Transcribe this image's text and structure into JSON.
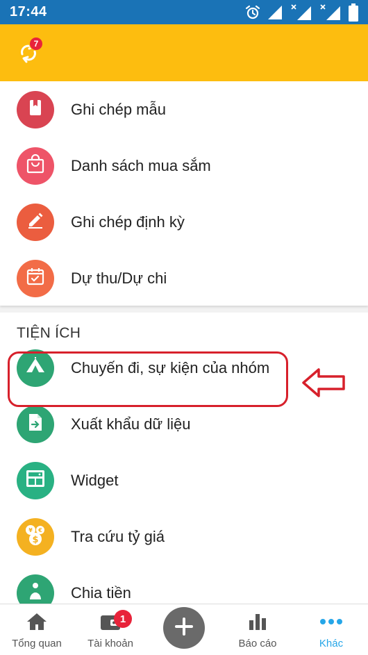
{
  "status_bar": {
    "time": "17:44"
  },
  "app_bar": {
    "sync_badge": "7"
  },
  "section1": {
    "items": [
      {
        "label": "Ghi chép mẫu",
        "color": "#d94452"
      },
      {
        "label": "Danh sách mua sắm",
        "color": "#ee5468"
      },
      {
        "label": "Ghi chép định kỳ",
        "color": "#eb5d3f"
      },
      {
        "label": "Dự thu/Dự chi",
        "color": "#f26c47"
      }
    ]
  },
  "section2": {
    "header": "TIỆN ÍCH",
    "items": [
      {
        "label": "Chuyến đi, sự kiện của nhóm",
        "color": "#2ea574"
      },
      {
        "label": "Xuất khẩu dữ liệu",
        "color": "#2ea574"
      },
      {
        "label": "Widget",
        "color": "#29b183"
      },
      {
        "label": "Tra cứu tỷ giá",
        "color": "#f4b121"
      },
      {
        "label": "Chia tiền",
        "color": "#2ea574"
      }
    ]
  },
  "bottom_nav": {
    "items": [
      {
        "label": "Tổng quan"
      },
      {
        "label": "Tài khoản",
        "badge": "1"
      },
      {
        "label": ""
      },
      {
        "label": "Báo cáo"
      },
      {
        "label": "Khác"
      }
    ],
    "active_color": "#26a6e8"
  }
}
